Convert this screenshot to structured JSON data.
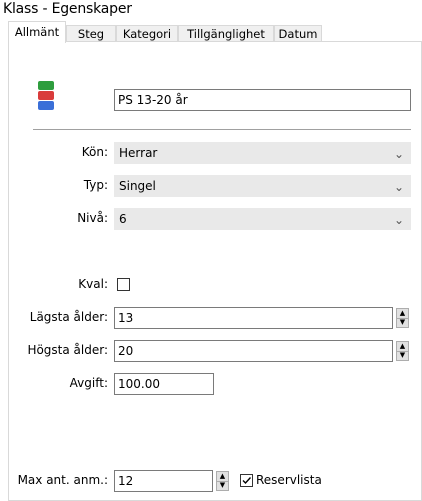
{
  "window": {
    "title": "Klass - Egenskaper"
  },
  "tabs": [
    "Allmänt",
    "Steg",
    "Kategori",
    "Tillgänglighet",
    "Datum"
  ],
  "general": {
    "name_value": "PS 13-20 år",
    "gender": {
      "label": "Kön:",
      "value": "Herrar"
    },
    "type": {
      "label": "Typ:",
      "value": "Singel"
    },
    "level": {
      "label": "Nivå:",
      "value": "6"
    },
    "qualification": {
      "label": "Kval:",
      "checked": false
    },
    "min_age": {
      "label": "Lägsta ålder:",
      "value": "13"
    },
    "max_age": {
      "label": "Högsta ålder:",
      "value": "20"
    },
    "fee": {
      "label": "Avgift:",
      "value": "100.00"
    },
    "max_entries": {
      "label": "Max ant. anm.:",
      "value": "12"
    },
    "reserve_list": {
      "label": "Reservlista",
      "checked": true
    }
  },
  "colors": {
    "icon_top": "#2e9d3e",
    "icon_mid": "#d93b3b",
    "icon_bot": "#3a6fd8"
  }
}
